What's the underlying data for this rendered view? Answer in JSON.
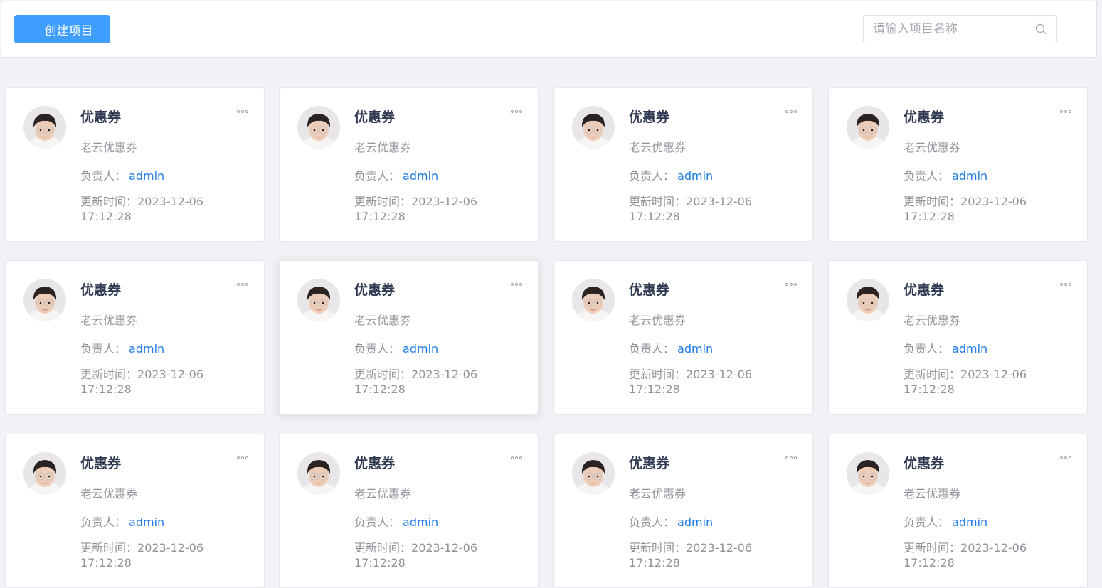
{
  "toolbar": {
    "create_label": "创建项目",
    "search_placeholder": "请输入项目名称",
    "accent": "#409eff"
  },
  "cards": [
    {
      "title": "优惠券",
      "desc": "老云优惠券",
      "owner_label": "负责人：",
      "owner": "admin",
      "updated_label": "更新时间：",
      "updated_date": "2023-12-06",
      "updated_time": "17:12:28"
    },
    {
      "title": "优惠券",
      "desc": "老云优惠券",
      "owner_label": "负责人：",
      "owner": "admin",
      "updated_label": "更新时间：",
      "updated_date": "2023-12-06",
      "updated_time": "17:12:28"
    },
    {
      "title": "优惠券",
      "desc": "老云优惠券",
      "owner_label": "负责人：",
      "owner": "admin",
      "updated_label": "更新时间：",
      "updated_date": "2023-12-06",
      "updated_time": "17:12:28"
    },
    {
      "title": "优惠券",
      "desc": "老云优惠券",
      "owner_label": "负责人：",
      "owner": "admin",
      "updated_label": "更新时间：",
      "updated_date": "2023-12-06",
      "updated_time": "17:12:28"
    },
    {
      "title": "优惠券",
      "desc": "老云优惠券",
      "owner_label": "负责人：",
      "owner": "admin",
      "updated_label": "更新时间：",
      "updated_date": "2023-12-06",
      "updated_time": "17:12:28"
    },
    {
      "title": "优惠券",
      "desc": "老云优惠券",
      "owner_label": "负责人：",
      "owner": "admin",
      "updated_label": "更新时间：",
      "updated_date": "2023-12-06",
      "updated_time": "17:12:28"
    },
    {
      "title": "优惠券",
      "desc": "老云优惠券",
      "owner_label": "负责人：",
      "owner": "admin",
      "updated_label": "更新时间：",
      "updated_date": "2023-12-06",
      "updated_time": "17:12:28"
    },
    {
      "title": "优惠券",
      "desc": "老云优惠券",
      "owner_label": "负责人：",
      "owner": "admin",
      "updated_label": "更新时间：",
      "updated_date": "2023-12-06",
      "updated_time": "17:12:28"
    },
    {
      "title": "优惠券",
      "desc": "老云优惠券",
      "owner_label": "负责人：",
      "owner": "admin",
      "updated_label": "更新时间：",
      "updated_date": "2023-12-06",
      "updated_time": "17:12:28"
    },
    {
      "title": "优惠券",
      "desc": "老云优惠券",
      "owner_label": "负责人：",
      "owner": "admin",
      "updated_label": "更新时间：",
      "updated_date": "2023-12-06",
      "updated_time": "17:12:28"
    },
    {
      "title": "优惠券",
      "desc": "老云优惠券",
      "owner_label": "负责人：",
      "owner": "admin",
      "updated_label": "更新时间：",
      "updated_date": "2023-12-06",
      "updated_time": "17:12:28"
    },
    {
      "title": "优惠券",
      "desc": "老云优惠券",
      "owner_label": "负责人：",
      "owner": "admin",
      "updated_label": "更新时间：",
      "updated_date": "2023-12-06",
      "updated_time": "17:12:28"
    }
  ]
}
